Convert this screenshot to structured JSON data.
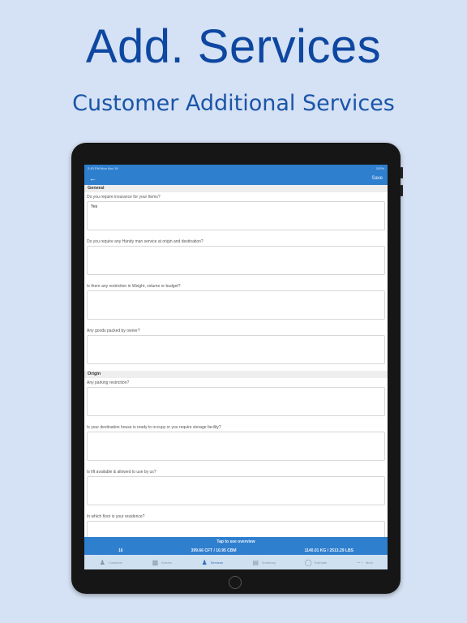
{
  "hero": {
    "title": "Add. Services",
    "subtitle": "Customer Additional Services"
  },
  "status_bar": {
    "time": "2:43 PM  Mon Nov 18",
    "battery": "100%"
  },
  "nav": {
    "back_icon": "arrow-left-icon",
    "save_label": "Save"
  },
  "sections": [
    {
      "title": "General",
      "questions": [
        {
          "label": "Do you require insurance for your Items?",
          "answer": "Yes"
        },
        {
          "label": "Do you require any Handy man service at origin and destination?",
          "answer": ""
        },
        {
          "label": "Is there any restriction in Weight, volume or budget?",
          "answer": ""
        },
        {
          "label": "Any goods packed by owner?",
          "answer": ""
        }
      ]
    },
    {
      "title": "Origin",
      "questions": [
        {
          "label": "Any parking restriction?",
          "answer": ""
        },
        {
          "label": "Is your destination house is ready to occupy or you require storage facility?",
          "answer": ""
        },
        {
          "label": "Is lift available & allowed to use by us?",
          "answer": ""
        },
        {
          "label": "In which floor is your residence?",
          "answer": ""
        }
      ]
    }
  ],
  "overview": {
    "tap_label": "Tap to see overview",
    "count": "16",
    "volume": "399.66 CFT / 10.95 CBM",
    "weight": "1140.01 KG / 2513.29 LBS"
  },
  "tabs": [
    {
      "label": "Customer",
      "icon": "person-icon",
      "active": false
    },
    {
      "label": "Articles",
      "icon": "furniture-icon",
      "active": false
    },
    {
      "label": "Services",
      "icon": "person-icon",
      "active": true
    },
    {
      "label": "Summary",
      "icon": "clipboard-icon",
      "active": false
    },
    {
      "label": "Estimate",
      "icon": "dollar-icon",
      "active": false
    },
    {
      "label": "More",
      "icon": "more-icon",
      "active": false
    }
  ],
  "colors": {
    "background": "#d5e1f4",
    "brand_blue": "#2f7fcf",
    "title_blue": "#0d47a1"
  }
}
